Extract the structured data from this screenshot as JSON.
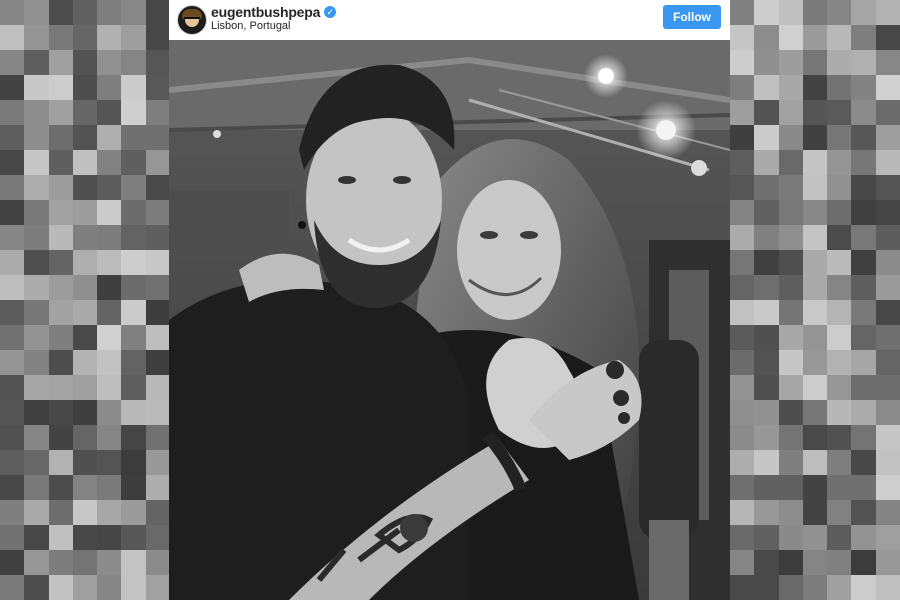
{
  "post": {
    "username": "eugentbushpepa",
    "location": "Lisbon, Portugal",
    "verified": true,
    "follow_label": "Follow",
    "avatar_icon": "profile-avatar",
    "verified_icon": "verified-check",
    "photo": "black-and-white-selfie"
  },
  "colors": {
    "follow_button": "#3897f0",
    "verified_badge": "#3897f0",
    "username_text": "#262626"
  }
}
